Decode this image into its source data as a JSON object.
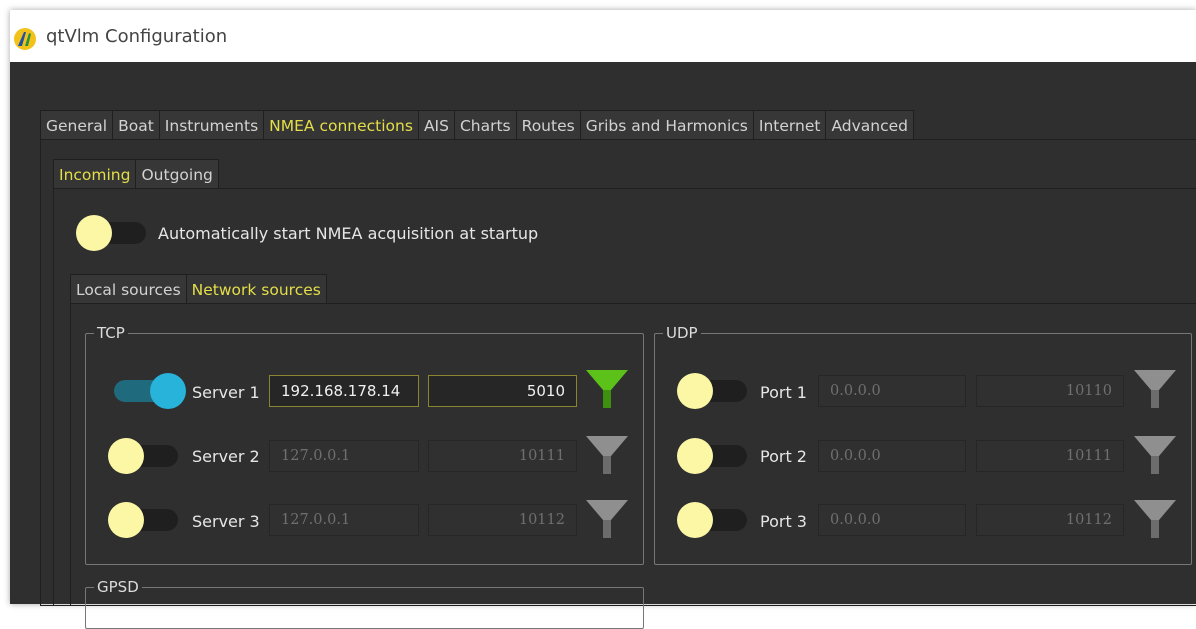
{
  "window": {
    "title": "qtVlm Configuration"
  },
  "main_tabs": [
    "General",
    "Boat",
    "Instruments",
    "NMEA connections",
    "AIS",
    "Charts",
    "Routes",
    "Gribs and Harmonics",
    "Internet",
    "Advanced"
  ],
  "main_active_tab": "NMEA connections",
  "direction_tabs": [
    "Incoming",
    "Outgoing"
  ],
  "direction_active_tab": "Incoming",
  "auto_start": {
    "label": "Automatically start NMEA acquisition at startup",
    "enabled": false
  },
  "source_tabs": [
    "Local sources",
    "Network sources"
  ],
  "source_active_tab": "Network sources",
  "tcp": {
    "title": "TCP",
    "servers": [
      {
        "label": "Server 1",
        "address": "192.168.178.14",
        "port": "5010",
        "enabled": true
      },
      {
        "label": "Server 2",
        "address": "127.0.0.1",
        "port": "10111",
        "enabled": false
      },
      {
        "label": "Server 3",
        "address": "127.0.0.1",
        "port": "10112",
        "enabled": false
      }
    ]
  },
  "udp": {
    "title": "UDP",
    "ports": [
      {
        "label": "Port 1",
        "address": "0.0.0.0",
        "port": "10110",
        "enabled": false
      },
      {
        "label": "Port 2",
        "address": "0.0.0.0",
        "port": "10111",
        "enabled": false
      },
      {
        "label": "Port 3",
        "address": "0.0.0.0",
        "port": "10112",
        "enabled": false
      }
    ]
  },
  "gpsd": {
    "title": "GPSD"
  },
  "colors": {
    "accent": "#e4de48",
    "toggle_on": "#27b3da",
    "toggle_off_knob": "#fbf7a4",
    "filter_active": "#5cc21a",
    "filter_inactive": "#8f8f8f"
  },
  "icons": {
    "app": "qtvlm-logo-icon",
    "filter": "funnel-filter-icon"
  }
}
